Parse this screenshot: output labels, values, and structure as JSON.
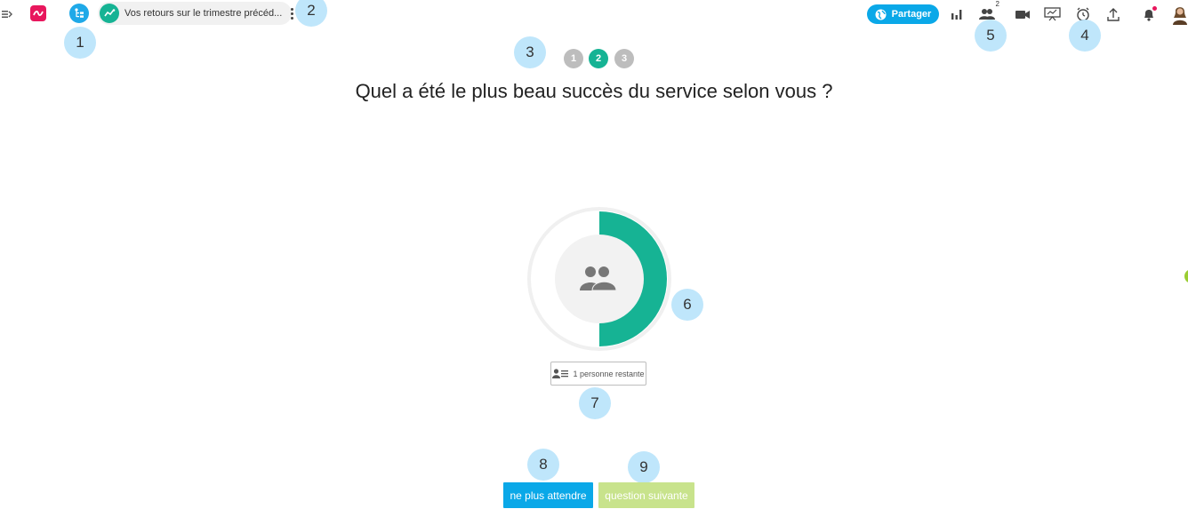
{
  "topbar": {
    "activity_title": "Vos retours sur le trimestre précéd...",
    "share_label": "Partager",
    "participants_count": "2"
  },
  "callouts": [
    "1",
    "2",
    "3",
    "4",
    "5",
    "6",
    "7",
    "8",
    "9"
  ],
  "steps": [
    "1",
    "2",
    "3"
  ],
  "active_step": "2",
  "question": "Quel a été le plus beau succès du service selon vous ?",
  "progress": {
    "answered_fraction": 0.5
  },
  "waiting_label": "1 personne restante",
  "buttons": {
    "stop_waiting": "ne plus attendre",
    "next_question": "question suivante"
  },
  "colors": {
    "accent": "#16b394",
    "share": "#0aa8e8",
    "brand": "#e8175d",
    "next_disabled": "#c8e38c",
    "callout": "#bfe6fb"
  },
  "icons": [
    "menu-icon",
    "app-logo-icon",
    "tree-icon",
    "activity-chart-icon",
    "more-icon",
    "globe-icon",
    "bar-chart-icon",
    "participants-icon",
    "video-icon",
    "presentation-icon",
    "timer-icon",
    "upload-icon",
    "bell-icon",
    "user-avatar",
    "users-icon",
    "user-list-icon"
  ]
}
